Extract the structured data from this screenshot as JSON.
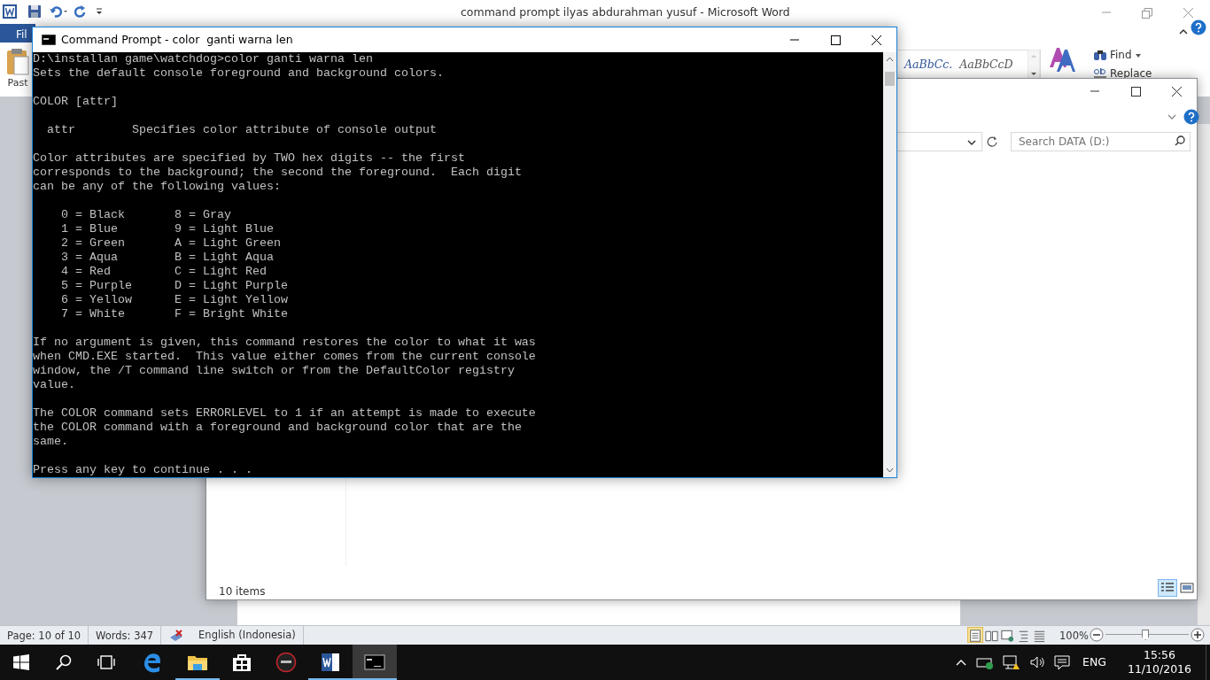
{
  "word": {
    "title": "command prompt ilyas abdurahman yusuf - Microsoft Word",
    "file_tab": "Fil",
    "paste_label": "Past",
    "styles": [
      "AaBbCc.",
      "AaBbCcD"
    ],
    "find": "Find",
    "replace": "Replace",
    "status": {
      "page": "Page: 10 of 10",
      "words": "Words: 347",
      "language": "English (Indonesia)",
      "zoom": "100%",
      "zoom_slider": {
        "level": 0.48
      }
    }
  },
  "explorer": {
    "search_placeholder": "Search DATA (D:)",
    "status": "10 items",
    "views": [
      {
        "kind": "details",
        "selected": true
      },
      {
        "kind": "thumbnails",
        "selected": false
      }
    ]
  },
  "console": {
    "title": "Command Prompt - color  ganti warna len",
    "blocks": [
      [
        "D:\\installan game\\watchdog>color ganti warna len",
        "Sets the default console foreground and background colors."
      ],
      [
        "COLOR [attr]"
      ],
      [
        "  attr        Specifies color attribute of console output"
      ],
      [
        "Color attributes are specified by TWO hex digits -- the first",
        "corresponds to the background; the second the foreground.  Each digit",
        "can be any of the following values:"
      ],
      [
        "    0 = Black       8 = Gray",
        "    1 = Blue        9 = Light Blue",
        "    2 = Green       A = Light Green",
        "    3 = Aqua        B = Light Aqua",
        "    4 = Red         C = Light Red",
        "    5 = Purple      D = Light Purple",
        "    6 = Yellow      E = Light Yellow",
        "    7 = White       F = Bright White"
      ],
      [
        "If no argument is given, this command restores the color to what it was",
        "when CMD.EXE started.  This value either comes from the current console",
        "window, the /T command line switch or from the DefaultColor registry",
        "value."
      ],
      [
        "The COLOR command sets ERRORLEVEL to 1 if an attempt is made to execute",
        "the COLOR command with a foreground and background color that are the",
        "same."
      ],
      [
        "Press any key to continue . . ."
      ]
    ]
  },
  "taskbar": {
    "apps": [
      {
        "kind": "edge",
        "running": false,
        "active": false
      },
      {
        "kind": "folder",
        "running": true,
        "active": false
      },
      {
        "kind": "store",
        "running": false,
        "active": false
      },
      {
        "kind": "ring",
        "running": false,
        "active": false
      },
      {
        "kind": "word",
        "running": true,
        "active": false
      },
      {
        "kind": "console",
        "running": true,
        "active": true
      }
    ],
    "language": "ENG",
    "time": "15:56",
    "date": "11/10/2016"
  }
}
